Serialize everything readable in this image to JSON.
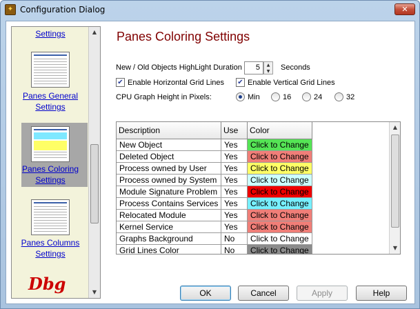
{
  "window": {
    "title": "Configuration Dialog",
    "close_glyph": "✕",
    "icon": "app-icon"
  },
  "nav": {
    "items": [
      {
        "label_line1": "",
        "label_line2": "Settings"
      },
      {
        "label_line1": "Panes General",
        "label_line2": "Settings"
      },
      {
        "label_line1": "Panes Coloring",
        "label_line2": "Settings"
      },
      {
        "label_line1": "Panes Columns",
        "label_line2": "Settings"
      }
    ],
    "selected_index": 2,
    "logo_text": "Dbg"
  },
  "page": {
    "title": "Panes Coloring Settings",
    "highlight_label": "New / Old Objects HighLight Duration",
    "highlight_value": "5",
    "highlight_unit": "Seconds",
    "horizontal_grid_label": "Enable Horizontal Grid Lines",
    "horizontal_grid_checked": true,
    "vertical_grid_label": "Enable Vertical Grid Lines",
    "vertical_grid_checked": true,
    "cpu_height_label": "CPU Graph Height in Pixels:",
    "cpu_options": [
      "Min",
      "16",
      "24",
      "32"
    ],
    "cpu_selected": "Min"
  },
  "grid": {
    "columns": [
      "Description",
      "Use",
      "Color"
    ],
    "rows": [
      {
        "description": "New Object",
        "use": "Yes",
        "color_label": "Click to Change",
        "bg": "#55e455",
        "fg": "#000000"
      },
      {
        "description": "Deleted Object",
        "use": "Yes",
        "color_label": "Click to Change",
        "bg": "#f07e78",
        "fg": "#000000"
      },
      {
        "description": "Process owned by User",
        "use": "Yes",
        "color_label": "Click to Change",
        "bg": "#ffff66",
        "fg": "#000000"
      },
      {
        "description": "Process owned by System",
        "use": "Yes",
        "color_label": "Click to Change",
        "bg": "#ccffff",
        "fg": "#000000"
      },
      {
        "description": "Module Signature Problem",
        "use": "Yes",
        "color_label": "Click to Change",
        "bg": "#ee0000",
        "fg": "#000000"
      },
      {
        "description": "Process Contains Services",
        "use": "Yes",
        "color_label": "Click to Change",
        "bg": "#77f0ff",
        "fg": "#000000"
      },
      {
        "description": "Relocated Module",
        "use": "Yes",
        "color_label": "Click to Change",
        "bg": "#f07e78",
        "fg": "#000000"
      },
      {
        "description": "Kernel Service",
        "use": "Yes",
        "color_label": "Click to Change",
        "bg": "#f07e78",
        "fg": "#000000"
      },
      {
        "description": "Graphs Background",
        "use": "No",
        "color_label": "Click to Change",
        "bg": "#ffffff",
        "fg": "#000000"
      },
      {
        "description": "Grid Lines Color",
        "use": "No",
        "color_label": "Click to Change",
        "bg": "#8c8c8c",
        "fg": "#000000"
      }
    ]
  },
  "buttons": {
    "ok": "OK",
    "cancel": "Cancel",
    "apply": "Apply",
    "help": "Help"
  }
}
